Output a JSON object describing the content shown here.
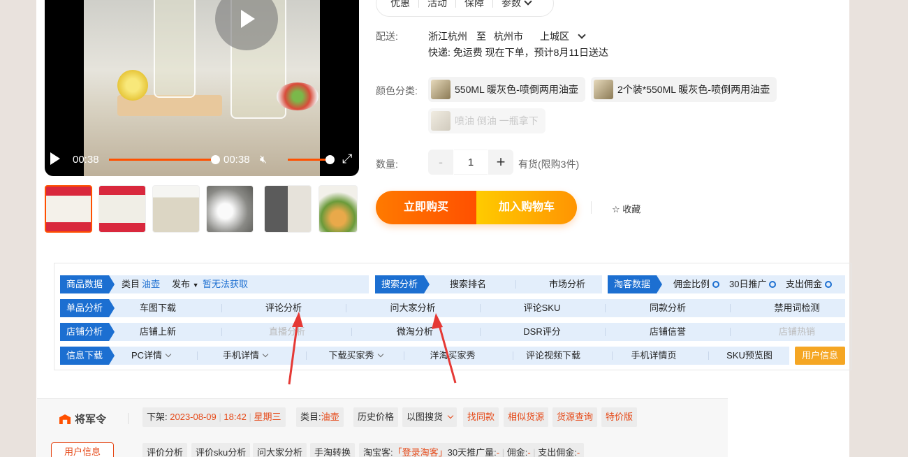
{
  "video": {
    "current_time": "00:38",
    "duration": "00:38",
    "progress": 1.0,
    "volume": 1.0
  },
  "promo_tabs": [
    "优惠",
    "活动",
    "保障",
    "参数"
  ],
  "shipping": {
    "label": "配送:",
    "from": "浙江杭州",
    "to_word": "至",
    "city": "杭州市",
    "district": "上城区",
    "line2": "快递: 免运费  现在下单，预计8月11日送达"
  },
  "color": {
    "label": "颜色分类:",
    "options": [
      "550ML 暖灰色-喷倒两用油壶",
      "2个装*550ML 暖灰色-喷倒两用油壶",
      "喷油 倒油 一瓶拿下"
    ]
  },
  "quantity": {
    "label": "数量:",
    "minus": "-",
    "value": "1",
    "plus": "+",
    "stock": "有货(限购3件)"
  },
  "actions": {
    "buy_now": "立即购买",
    "add_cart": "加入购物车",
    "favorite": "☆ 收藏"
  },
  "plugin": {
    "row1": {
      "tag": "商品数据",
      "category_label": "类目",
      "category_value": "油壶",
      "publish_label": "发布",
      "publish_value": "暂无法获取",
      "search_tag": "搜索分析",
      "search_rank": "搜索排名",
      "market": "市场分析",
      "taoke_tag": "淘客数据",
      "commission": "佣金比例",
      "promo30": "30日推广",
      "paid": "支出佣金"
    },
    "row2": {
      "tag": "单品分析",
      "items": [
        "车图下载",
        "评论分析",
        "问大家分析",
        "评论SKU",
        "同款分析",
        "禁用词检测"
      ]
    },
    "row3": {
      "tag": "店铺分析",
      "items": [
        "店铺上新",
        "直播分析",
        "微淘分析",
        "DSR评分",
        "店铺信誉",
        "店铺热销"
      ]
    },
    "row4": {
      "tag": "信息下载",
      "items": [
        "PC详情",
        "手机详情",
        "下载买家秀",
        "洋淘买家秀",
        "评论视频下载",
        "手机详情页",
        "SKU预览图"
      ],
      "user_info": "用户信息"
    }
  },
  "bottom": {
    "logo": "将军令",
    "off_label": "下架:",
    "off_date": "2023-08-09",
    "off_time": "18:42",
    "off_day": "星期三",
    "category_label": "类目:",
    "category_value": "油壶",
    "history": "历史价格",
    "image_search": "以图搜货",
    "find_same": "找同款",
    "similar": "相似货源",
    "source": "货源查询",
    "special": "特价版",
    "user_info": "用户信息",
    "row2": [
      "评价分析",
      "评价sku分析",
      "问大家分析",
      "手淘转换"
    ],
    "taoke_label": "淘宝客:",
    "taoke_login": "「登录淘客」",
    "promo30_label": "30天推广量:",
    "promo30_val": "-",
    "commission_label": "佣金:",
    "commission_val": "-",
    "paid_label": "支出佣金:",
    "paid_val": "-"
  },
  "colors": {
    "accent": "#ff5000",
    "blue": "#1c6fd1",
    "orange": "#f5a623",
    "panel_row": "#e3eefb"
  }
}
